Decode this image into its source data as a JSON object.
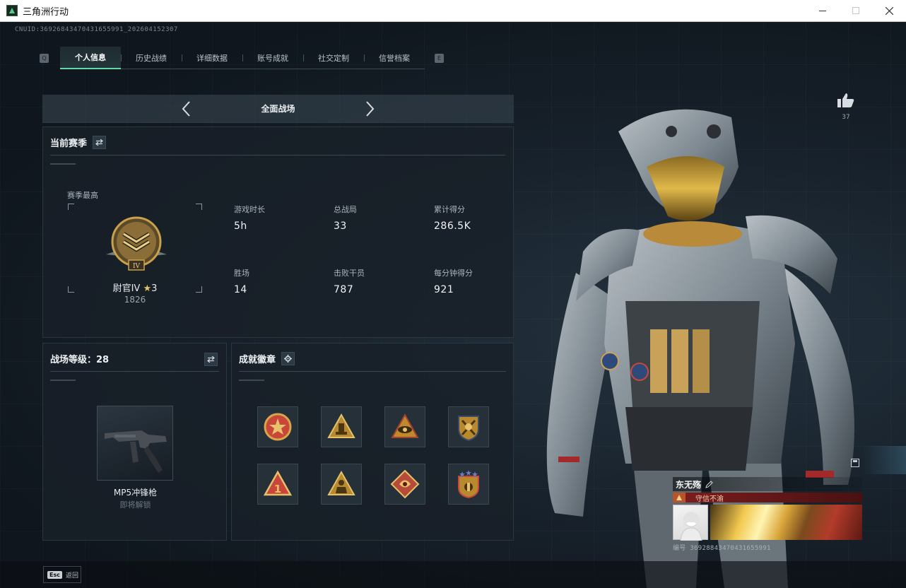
{
  "window": {
    "title": "三角洲行动",
    "controls": [
      "minimize",
      "maximize",
      "close"
    ]
  },
  "uid_text": "CNUID:3692684347043165599​1_202604152307",
  "tabs": {
    "left_key": "Q",
    "right_key": "E",
    "items": [
      {
        "label": "个人信息",
        "active": true
      },
      {
        "label": "历史战绩",
        "active": false
      },
      {
        "label": "详细数据",
        "active": false
      },
      {
        "label": "账号成就",
        "active": false
      },
      {
        "label": "社交定制",
        "active": false
      },
      {
        "label": "信誉档案",
        "active": false
      }
    ]
  },
  "mode_selector": {
    "label": "全面战场",
    "prev_icon": "chevron-left-icon",
    "next_icon": "chevron-right-icon"
  },
  "season": {
    "title": "当前赛季",
    "switch_icon": "swap-icon",
    "season_high_label": "赛季最高",
    "rank_name": "尉官IV",
    "rank_stars": "3",
    "rank_score": "1826",
    "stats": [
      {
        "label": "游戏时长",
        "value": "5h"
      },
      {
        "label": "总战局",
        "value": "33"
      },
      {
        "label": "累计得分",
        "value": "286.5K"
      },
      {
        "label": "胜场",
        "value": "14"
      },
      {
        "label": "击败干员",
        "value": "787"
      },
      {
        "label": "每分钟得分",
        "value": "921"
      }
    ]
  },
  "level": {
    "title": "战场等级：28",
    "switch_icon": "swap-icon",
    "weapon_name": "MP5冲锋枪",
    "weapon_status": "即将解锁"
  },
  "badges": {
    "title": "成就徽章",
    "settings_icon": "gear-icon",
    "items": [
      {
        "name": "badge-star-wreath",
        "color": "#c9473a"
      },
      {
        "name": "badge-triangle-tower",
        "color": "#b8892e"
      },
      {
        "name": "badge-triangle-eye",
        "color": "#c08a2c"
      },
      {
        "name": "badge-shield-crossed",
        "color": "#b8892e"
      },
      {
        "name": "badge-triangle-one",
        "color": "#c9473a"
      },
      {
        "name": "badge-triangle-soldier",
        "color": "#b8892e"
      },
      {
        "name": "badge-diamond-beast",
        "color": "#b84a3a"
      },
      {
        "name": "badge-shield-stars",
        "color": "#b8892e"
      }
    ]
  },
  "like": {
    "icon": "thumbs-up-icon",
    "count": "37"
  },
  "name_card": {
    "player_name": "东无殇",
    "edit_icon": "pencil-icon",
    "title_text": "守信不渝",
    "id_text": "编号 36928843470431655991"
  },
  "bottom": {
    "esc_key": "Esc",
    "back_label": "返回"
  },
  "colors": {
    "accent": "#5fd9a8",
    "panel_bg": "#182028",
    "gold": "#c9a14a",
    "title_red": "#7a1c1c"
  }
}
